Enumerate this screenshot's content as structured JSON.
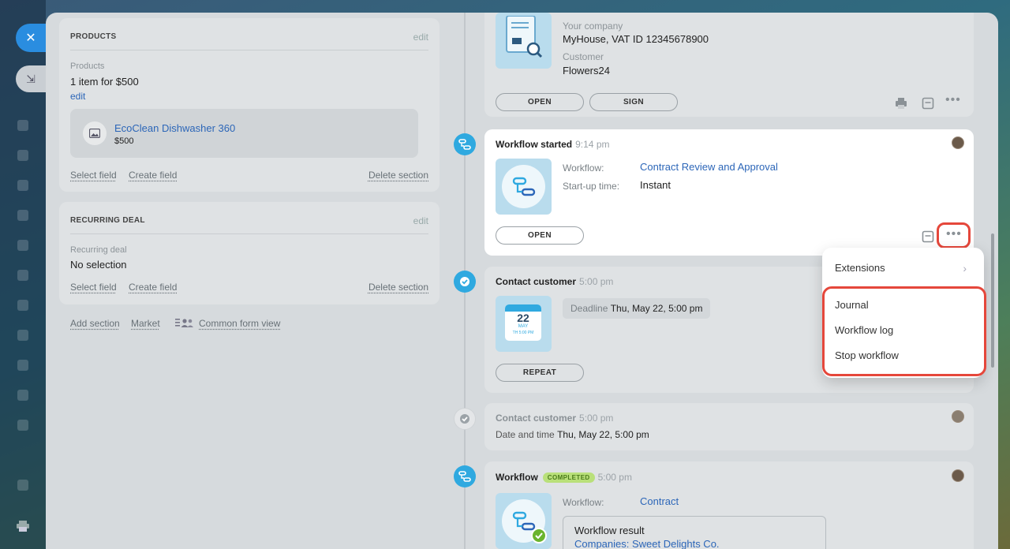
{
  "products_card": {
    "head": "PRODUCTS",
    "edit": "edit",
    "products_label": "Products",
    "products_value": "1 item for $500",
    "products_edit": "edit",
    "product_name": "EcoClean Dishwasher 360",
    "product_price": "$500",
    "select_field": "Select field",
    "create_field": "Create field",
    "delete_section": "Delete section"
  },
  "recurring_card": {
    "head": "RECURRING DEAL",
    "edit": "edit",
    "label": "Recurring deal",
    "value": "No selection",
    "select_field": "Select field",
    "create_field": "Create field",
    "delete_section": "Delete section"
  },
  "bottom_links": {
    "add_section": "Add section",
    "market": "Market",
    "common_form_view": "Common form view"
  },
  "document_card": {
    "company_label": "Your company",
    "company_value": "MyHouse, VAT ID 12345678900",
    "customer_label": "Customer",
    "customer_value": "Flowers24",
    "open": "OPEN",
    "sign": "SIGN"
  },
  "workflow_started": {
    "title": "Workflow started",
    "time": "9:14 pm",
    "workflow_label": "Workflow:",
    "workflow_value": "Contract Review and Approval",
    "startup_label": "Start-up time:",
    "startup_value": "Instant",
    "open": "OPEN"
  },
  "contact_customer": {
    "title": "Contact customer",
    "time": "5:00 pm",
    "deadline_label": "Deadline",
    "deadline_value": "Thu, May 22, 5:00 pm",
    "cal_day": "22",
    "cal_month": "MAY",
    "cal_time": "TH 5:00 PM",
    "repeat": "REPEAT"
  },
  "contact_customer_done": {
    "title": "Contact customer",
    "time": "5:00 pm",
    "date_label": "Date and time",
    "date_value": "Thu, May 22, 5:00 pm"
  },
  "workflow_completed": {
    "title": "Workflow",
    "badge": "COMPLETED",
    "time": "5:00 pm",
    "workflow_label": "Workflow:",
    "workflow_value": "Contract",
    "result_label": "Workflow result",
    "result_value": "Companies: Sweet Delights Co."
  },
  "menu": {
    "extensions": "Extensions",
    "journal": "Journal",
    "workflow_log": "Workflow log",
    "stop_workflow": "Stop workflow"
  },
  "colors": {
    "accent": "#2fa9e0",
    "link": "#2c66b8",
    "highlight": "#e5473b"
  }
}
